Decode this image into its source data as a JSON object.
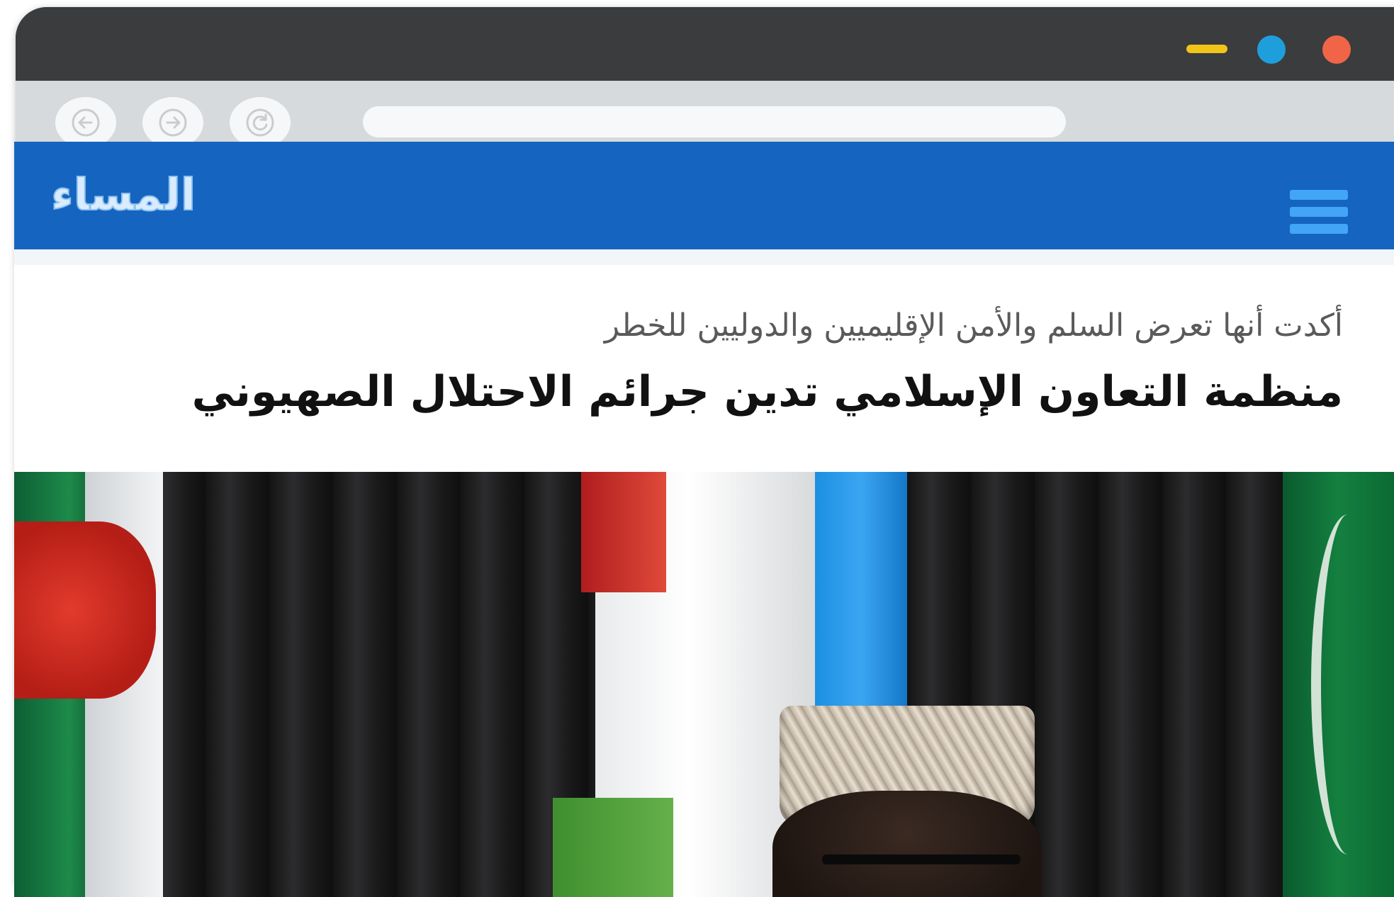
{
  "browser": {
    "window_controls": [
      "minimize",
      "maximize",
      "close"
    ],
    "nav_buttons": [
      "back-arrow-icon",
      "forward-arrow-icon",
      "reload-icon"
    ],
    "address_bar_value": ""
  },
  "site": {
    "logo_text": "المساء",
    "menu_icon": "hamburger-menu-icon",
    "header_color": "#1565c0"
  },
  "article": {
    "subtitle": "أكدت أنها تعرض السلم والأمن الإقليميين والدوليين للخطر",
    "headline": "منظمة التعاون الإسلامي تدين جرائم الاحتلال الصهيوني",
    "photo": "news-photo"
  },
  "colors": {
    "minimize": "#f0c419",
    "maximize": "#1e9fdc",
    "close": "#f06548"
  }
}
